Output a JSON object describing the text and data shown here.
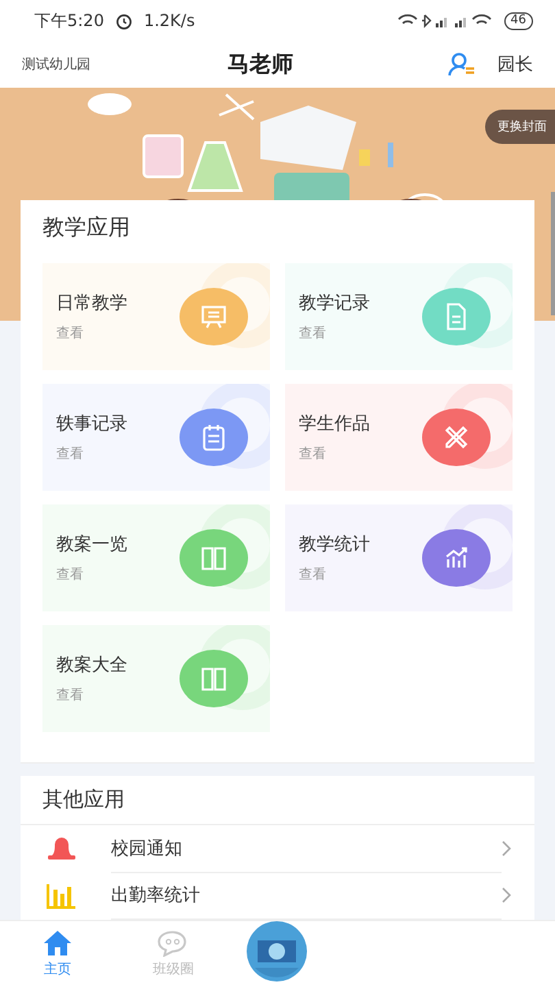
{
  "status_bar": {
    "time": "下午5:20",
    "speed": "1.2K/s",
    "battery": "46"
  },
  "header": {
    "school": "测试幼儿园",
    "title": "马老师",
    "role": "园长"
  },
  "banner": {
    "button": "更换封面"
  },
  "teaching_apps": {
    "title": "教学应用",
    "tiles": [
      {
        "title": "日常教学",
        "sub": "查看",
        "kind": "board",
        "color": "#f6bd66"
      },
      {
        "title": "教学记录",
        "sub": "查看",
        "kind": "doc",
        "color": "#72dcc4"
      },
      {
        "title": "轶事记录",
        "sub": "查看",
        "kind": "clipboard",
        "color": "#7c98f4"
      },
      {
        "title": "学生作品",
        "sub": "查看",
        "kind": "pencil",
        "color": "#f46b6b"
      },
      {
        "title": "教案一览",
        "sub": "查看",
        "kind": "book",
        "color": "#78d67c"
      },
      {
        "title": "教学统计",
        "sub": "查看",
        "kind": "chart",
        "color": "#8a7be4"
      },
      {
        "title": "教案大全",
        "sub": "查看",
        "kind": "book",
        "color": "#78d67c"
      }
    ]
  },
  "other_apps": {
    "title": "其他应用",
    "items": [
      {
        "label": "校园通知",
        "kind": "bell"
      },
      {
        "label": "出勤率统计",
        "kind": "bars"
      }
    ]
  },
  "bottom_nav": [
    {
      "label": "主页",
      "kind": "home",
      "selected": true
    },
    {
      "label": "班级圈",
      "kind": "chat",
      "selected": false
    }
  ]
}
